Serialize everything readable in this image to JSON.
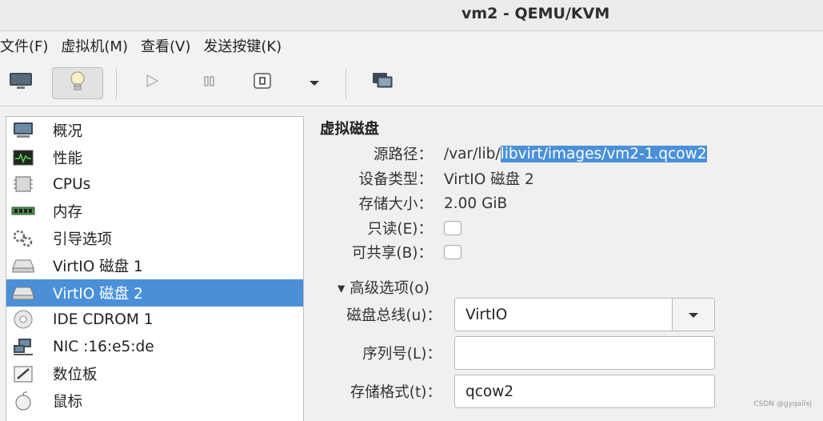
{
  "window": {
    "title": "vm2 - QEMU/KVM"
  },
  "menu": [
    "文件(F)",
    "虚拟机(M)",
    "查看(V)",
    "发送按键(K)"
  ],
  "sidebar": {
    "items": [
      {
        "label": "概况",
        "icon": "overview-icon"
      },
      {
        "label": "性能",
        "icon": "performance-icon"
      },
      {
        "label": "CPUs",
        "icon": "cpu-icon"
      },
      {
        "label": "内存",
        "icon": "memory-icon"
      },
      {
        "label": "引导选项",
        "icon": "boot-options-icon"
      },
      {
        "label": "VirtIO 磁盘 1",
        "icon": "disk-icon"
      },
      {
        "label": "VirtIO 磁盘 2",
        "icon": "disk-icon",
        "selected": true
      },
      {
        "label": "IDE CDROM 1",
        "icon": "cdrom-icon"
      },
      {
        "label": "NIC :16:e5:de",
        "icon": "nic-icon"
      },
      {
        "label": "数位板",
        "icon": "tablet-icon"
      },
      {
        "label": "鼠标",
        "icon": "mouse-icon"
      }
    ]
  },
  "details": {
    "section_title": "虚拟磁盘",
    "source_path_label": "源路径：",
    "source_path_prefix": "/var/lib/",
    "source_path_selected": "libvirt/images/vm2-1.qcow2",
    "device_type_label": "设备类型：",
    "device_type_value": "VirtIO 磁盘 2",
    "storage_size_label": "存储大小：",
    "storage_size_value": "2.00 GiB",
    "readonly_label": "只读(E)：",
    "readonly_checked": false,
    "shareable_label": "可共享(B)：",
    "shareable_checked": false,
    "advanced_label": "▾ 高级选项(o)",
    "disk_bus_label": "磁盘总线(u)：",
    "disk_bus_value": "VirtIO",
    "serial_label": "序列号(L)：",
    "serial_value": "",
    "storage_format_label": "存储格式(t)：",
    "storage_format_value": "qcow2"
  },
  "watermark": "CSDN @gyqailxj",
  "colors": {
    "selection": "#4a90d9"
  }
}
